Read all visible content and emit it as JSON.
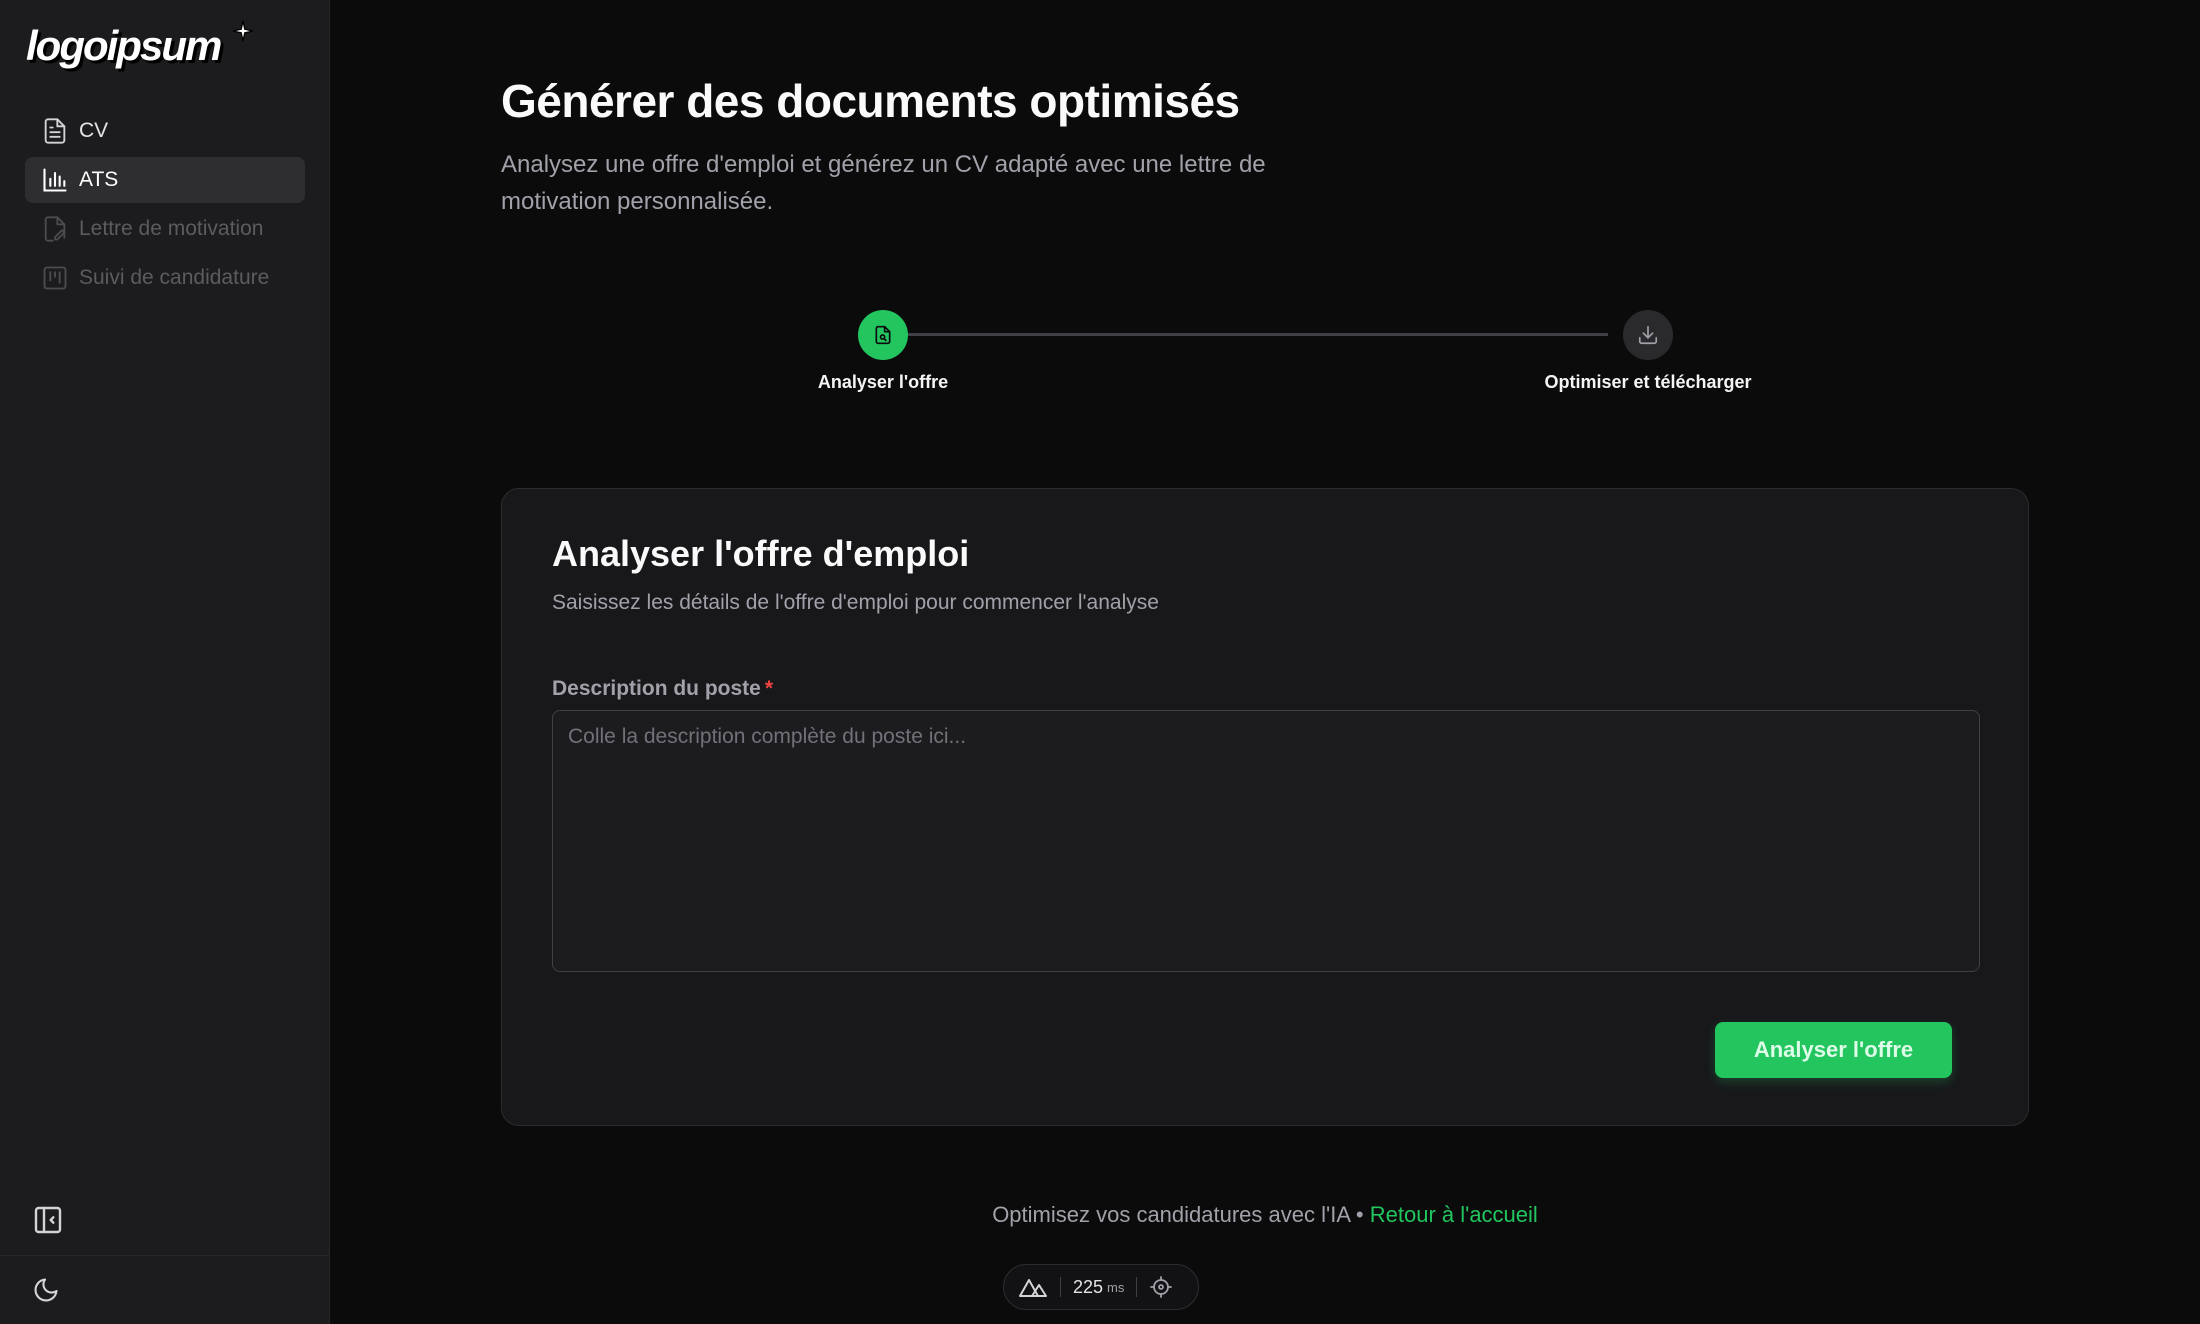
{
  "brand": {
    "logo_text": "logoipsum"
  },
  "sidebar": {
    "items": [
      {
        "label": "CV",
        "icon": "file-text-icon",
        "state": "normal"
      },
      {
        "label": "ATS",
        "icon": "bar-chart-icon",
        "state": "active"
      },
      {
        "label": "Lettre de motivation",
        "icon": "file-signature-icon",
        "state": "disabled"
      },
      {
        "label": "Suivi de candidature",
        "icon": "kanban-icon",
        "state": "disabled"
      }
    ],
    "collapse_icon": "sidebar-collapse-icon",
    "theme_icon": "moon-icon"
  },
  "page": {
    "title": "Générer des documents optimisés",
    "subtitle": "Analysez une offre d'emploi et générez un CV adapté avec une lettre de motivation personnalisée."
  },
  "stepper": {
    "steps": [
      {
        "label": "Analyser l'offre",
        "state": "active",
        "icon": "file-search-icon"
      },
      {
        "label": "Optimiser et télécharger",
        "state": "pending",
        "icon": "download-icon"
      }
    ]
  },
  "card": {
    "title": "Analyser l'offre d'emploi",
    "description": "Saisissez les détails de l'offre d'emploi pour commencer l'analyse",
    "field_label": "Description du poste",
    "required_mark": "*",
    "textarea_value": "",
    "textarea_placeholder": "Colle la description complète du poste ici...",
    "submit_label": "Analyser l'offre"
  },
  "footer": {
    "text": "Optimisez vos candidatures avec l'IA",
    "separator": "•",
    "link_label": "Retour à l'accueil"
  },
  "devbar": {
    "ms_value": "225",
    "ms_unit": "ms"
  },
  "colors": {
    "accent": "#22c55e",
    "background": "#0b0b0c",
    "sidebar": "#1c1c1e",
    "card": "#18181b",
    "required": "#ef4444"
  }
}
